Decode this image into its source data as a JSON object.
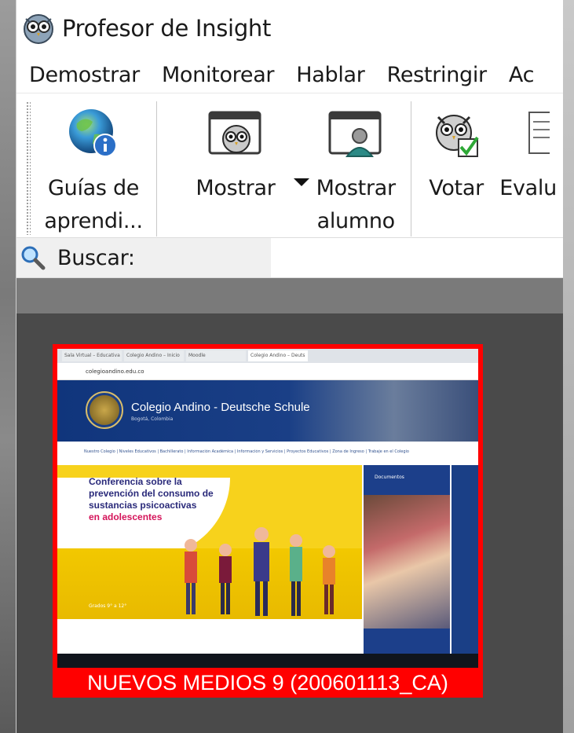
{
  "window": {
    "title": "Profesor de Insight"
  },
  "menu": {
    "items": [
      "Demostrar",
      "Monitorear",
      "Hablar",
      "Restringir",
      "Ac"
    ]
  },
  "ribbon": {
    "guides_line1": "Guías de",
    "guides_line2": "aprendi...",
    "show_label": "Mostrar",
    "show_student_line1": "Mostrar",
    "show_student_line2": "alumno",
    "vote_label": "Votar",
    "evaluate_label": "Evalu"
  },
  "search": {
    "label": "Buscar:",
    "value": ""
  },
  "thumbnail": {
    "caption": "NUEVOS MEDIOS 9 (200601113_CA)",
    "border_color": "#ff0000",
    "screen": {
      "tabs": [
        "Sala Virtual – Educativa",
        "Colegio Andino – Inicio",
        "Moodle",
        "Colegio Andino – Deuts"
      ],
      "address": "colegioandino.edu.co",
      "site_name": "Colegio Andino - Deutsche Schule",
      "site_sub": "Bogotá, Colombia",
      "nav": "Nuestro Colegio | Niveles Educativos | Bachillerato | Información Académica | Información y Servicios | Proyectos Educativos | Zona de Ingreso | Trabaje en el Colegio",
      "banner_line1": "Conferencia sobre la",
      "banner_line2": "prevención del consumo de",
      "banner_line3": "sustancias psicoactivas",
      "banner_line4": "en adolescentes",
      "banner_dates": "Grados 9° a 12°",
      "side_title": "Documentos"
    }
  }
}
